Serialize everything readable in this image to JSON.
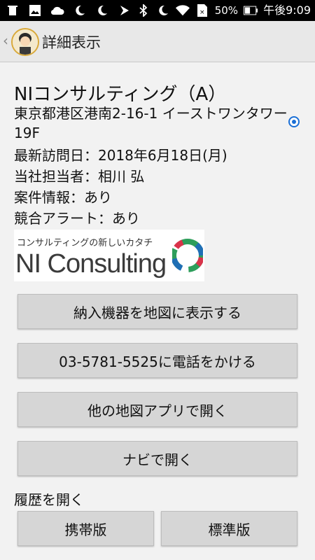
{
  "status_bar": {
    "battery_percent": "50%",
    "time": "午後9:09",
    "icons_left": [
      "trash-icon",
      "image-icon",
      "cloud-icon",
      "moon-icon",
      "moon-icon",
      "flag-icon"
    ],
    "icons_right": [
      "bluetooth-icon",
      "moon-icon",
      "wifi-icon",
      "sim-icon",
      "battery-icon"
    ]
  },
  "app_bar": {
    "title": "詳細表示"
  },
  "company": {
    "name": "NIコンサルティング（A）",
    "address": "東京都港区港南2-16-1 イーストワンタワー19F",
    "last_visit": "最新訪問日：2018年6月18日(月)",
    "rep": "当社担当者：相川 弘",
    "case_info": "案件情報：あり",
    "alert": "競合アラート：あり"
  },
  "logo": {
    "tagline": "コンサルティングの新しいカタチ",
    "wordmark": "NI Consulting"
  },
  "buttons": {
    "map": "納入機器を地図に表示する",
    "call": "03-5781-5525に電話をかける",
    "other_map": "他の地図アプリで開く",
    "navi": "ナビで開く"
  },
  "history": {
    "label": "履歴を開く",
    "mobile": "携帯版",
    "standard": "標準版"
  }
}
